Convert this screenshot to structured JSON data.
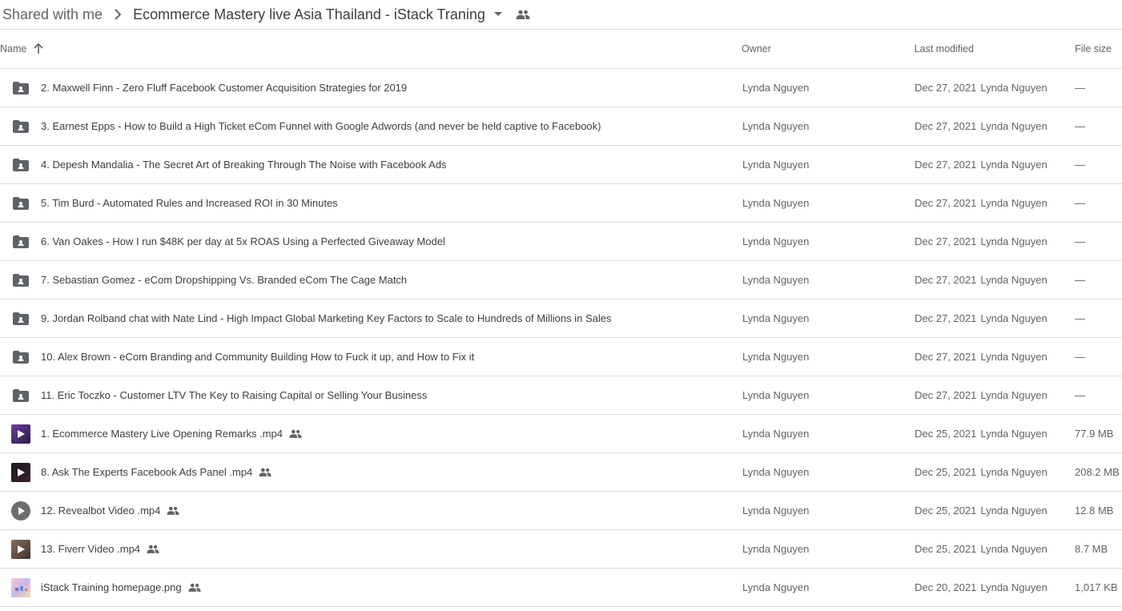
{
  "breadcrumb": {
    "root": "Shared with me",
    "current": "Ecommerce Mastery live Asia Thailand - iStack Traning"
  },
  "columns": {
    "name": "Name",
    "owner": "Owner",
    "last_modified": "Last modified",
    "file_size": "File size"
  },
  "files": [
    {
      "name": "2. Maxwell Finn - Zero Fluff Facebook Customer Acquisition Strategies for 2019",
      "owner": "Lynda Nguyen",
      "date": "Dec 27, 2021",
      "modified_by": "Lynda Nguyen",
      "size": "—"
    },
    {
      "name": "3. Earnest Epps - How to Build a High Ticket eCom Funnel with Google Adwords (and never be held captive to Facebook)",
      "owner": "Lynda Nguyen",
      "date": "Dec 27, 2021",
      "modified_by": "Lynda Nguyen",
      "size": "—"
    },
    {
      "name": "4. Depesh Mandalia - The Secret Art of Breaking Through The Noise with Facebook Ads",
      "owner": "Lynda Nguyen",
      "date": "Dec 27, 2021",
      "modified_by": "Lynda Nguyen",
      "size": "—"
    },
    {
      "name": "5. Tim Burd - Automated Rules and Increased ROI in 30 Minutes",
      "owner": "Lynda Nguyen",
      "date": "Dec 27, 2021",
      "modified_by": "Lynda Nguyen",
      "size": "—"
    },
    {
      "name": "6. Van Oakes - How I run $48K per day at 5x ROAS Using a Perfected Giveaway Model",
      "owner": "Lynda Nguyen",
      "date": "Dec 27, 2021",
      "modified_by": "Lynda Nguyen",
      "size": "—"
    },
    {
      "name": "7. Sebastian Gomez - eCom Dropshipping Vs. Branded eCom The Cage Match",
      "owner": "Lynda Nguyen",
      "date": "Dec 27, 2021",
      "modified_by": "Lynda Nguyen",
      "size": "—"
    },
    {
      "name": "9. Jordan Rolband chat with Nate Lind - High Impact Global Marketing Key Factors to Scale to Hundreds of Millions in Sales",
      "owner": "Lynda Nguyen",
      "date": "Dec 27, 2021",
      "modified_by": "Lynda Nguyen",
      "size": "—"
    },
    {
      "name": "10. Alex Brown - eCom Branding and Community Building How to Fuck it up, and How to Fix it",
      "owner": "Lynda Nguyen",
      "date": "Dec 27, 2021",
      "modified_by": "Lynda Nguyen",
      "size": "—"
    },
    {
      "name": "11. Eric Toczko - Customer LTV The Key to Raising Capital or Selling Your Business",
      "owner": "Lynda Nguyen",
      "date": "Dec 27, 2021",
      "modified_by": "Lynda Nguyen",
      "size": "—"
    },
    {
      "name": "1. Ecommerce Mastery Live Opening Remarks .mp4",
      "owner": "Lynda Nguyen",
      "date": "Dec 25, 2021",
      "modified_by": "Lynda Nguyen",
      "size": "77.9 MB"
    },
    {
      "name": "8. Ask The Experts Facebook Ads Panel .mp4",
      "owner": "Lynda Nguyen",
      "date": "Dec 25, 2021",
      "modified_by": "Lynda Nguyen",
      "size": "208.2 MB"
    },
    {
      "name": "12. Revealbot Video .mp4",
      "owner": "Lynda Nguyen",
      "date": "Dec 25, 2021",
      "modified_by": "Lynda Nguyen",
      "size": "12.8 MB"
    },
    {
      "name": "13. Fiverr Video .mp4",
      "owner": "Lynda Nguyen",
      "date": "Dec 25, 2021",
      "modified_by": "Lynda Nguyen",
      "size": "8.7 MB"
    },
    {
      "name": "iStack Training homepage.png",
      "owner": "Lynda Nguyen",
      "date": "Dec 20, 2021",
      "modified_by": "Lynda Nguyen",
      "size": "1,017 KB"
    }
  ],
  "icons": {
    "folder": "shared-folder-icon",
    "video": "video-thumbnail-icon",
    "image": "image-thumbnail-icon",
    "shared": "people-icon"
  },
  "colors": {
    "border": "#dadce0",
    "text": "#3c4043",
    "muted": "#5f6368",
    "folder": "#5f6368"
  }
}
